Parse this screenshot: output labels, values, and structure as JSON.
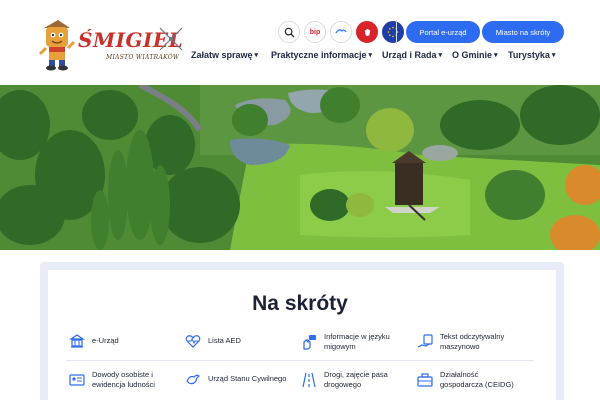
{
  "header": {
    "logo": {
      "brand": "ŚMIGIEL",
      "tagline": "MIASTO WIATRAKÓW"
    },
    "utility_icons": [
      {
        "name": "search-icon",
        "text": ""
      },
      {
        "name": "bip-icon",
        "text": "bip"
      },
      {
        "name": "sign-language-icon",
        "text": ""
      },
      {
        "name": "emblem-icon",
        "text": ""
      },
      {
        "name": "eu-flag-icon",
        "text": ""
      }
    ],
    "buttons": {
      "portal": "Portal e-urząd",
      "quick": "Miasto na skróty"
    },
    "nav": [
      {
        "label": "Załatw sprawę"
      },
      {
        "label": "Praktyczne informacje"
      },
      {
        "label": "Urząd i Rada"
      },
      {
        "label": "O Gminie"
      },
      {
        "label": "Turystyka"
      }
    ]
  },
  "quick": {
    "title": "Na skróty",
    "items": [
      {
        "label": "e-Urząd",
        "icon": "building-icon"
      },
      {
        "label": "Lista AED",
        "icon": "heart-pulse-icon"
      },
      {
        "label": "Informacje w języku migowym",
        "icon": "sign-language-icon"
      },
      {
        "label": "Tekst odczytywalny maszynowo",
        "icon": "hand-document-icon"
      },
      {
        "label": "Dowody osobiste i ewidencja ludności",
        "icon": "id-card-icon"
      },
      {
        "label": "Urząd Stanu Cywilnego",
        "icon": "doves-icon"
      },
      {
        "label": "Drogi, zajęcie pasa drogowego",
        "icon": "road-icon"
      },
      {
        "label": "Działalność gospodarcza (CEIDG)",
        "icon": "briefcase-icon"
      }
    ]
  },
  "colors": {
    "accent": "#2d6cf0",
    "text": "#1c2236",
    "logo_red": "#c8302c"
  }
}
